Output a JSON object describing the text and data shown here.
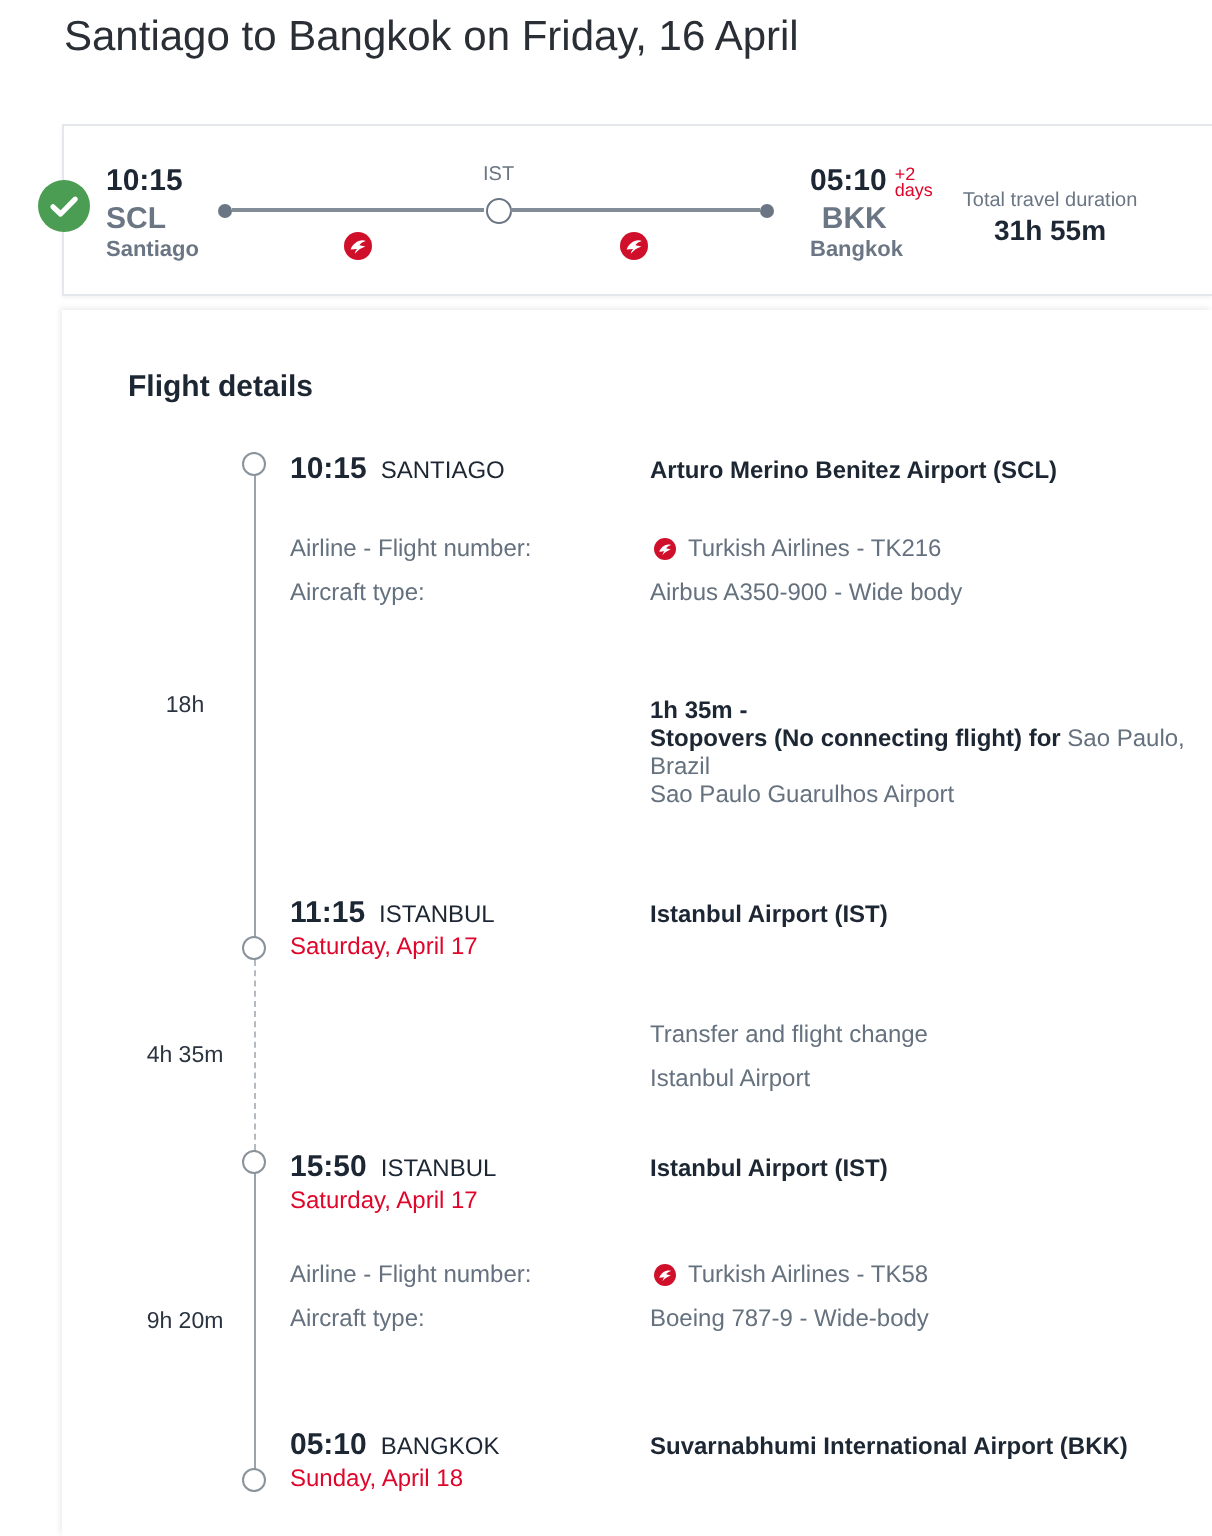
{
  "title": "Santiago to Bangkok on Friday, 16 April",
  "summary": {
    "departure": {
      "time": "10:15",
      "code": "SCL",
      "city": "Santiago"
    },
    "stops": [
      {
        "code": "IST"
      }
    ],
    "arrival": {
      "time": "05:10",
      "day_offset": "+2 days",
      "code": "BKK",
      "city": "Bangkok"
    },
    "total_duration": {
      "label": "Total travel duration",
      "value": "31h 55m"
    }
  },
  "details": {
    "heading": "Flight details",
    "timeline": [
      {
        "kind": "flight",
        "duration": "18h",
        "departure": {
          "time": "10:15",
          "city": "SANTIAGO",
          "airport": "Arturo Merino Benitez Airport (SCL)"
        },
        "info": [
          {
            "kind": "airline",
            "label": "Airline - Flight number:",
            "value": "Turkish Airlines - TK216"
          },
          {
            "kind": "aircraft",
            "label": "Aircraft type:",
            "value": "Airbus A350-900 - Wide body"
          }
        ],
        "stopover": {
          "duration": "1h 35m -",
          "note": "**Stopovers (No connecting flight) for** Sao Paulo, Brazil",
          "airport": "Sao Paulo Guarulhos Airport"
        },
        "arrival": {
          "time": "11:15",
          "city": "ISTANBUL",
          "date": "Saturday, April 17",
          "airport": "Istanbul Airport (IST)"
        }
      },
      {
        "kind": "transfer",
        "duration": "4h 35m",
        "lines": [
          "Transfer and flight change",
          "Istanbul Airport"
        ]
      },
      {
        "kind": "flight",
        "duration": "9h 20m",
        "departure": {
          "time": "15:50",
          "city": "ISTANBUL",
          "date": "Saturday, April 17",
          "airport": "Istanbul Airport (IST)"
        },
        "info": [
          {
            "kind": "airline",
            "label": "Airline - Flight number:",
            "value": "Turkish Airlines - TK58"
          },
          {
            "kind": "aircraft",
            "label": "Aircraft type:",
            "value": "Boeing 787-9 - Wide-body"
          }
        ],
        "arrival": {
          "time": "05:10",
          "city": "BANGKOK",
          "date": "Sunday, April 18",
          "airport": "Suvarnabhumi International Airport (BKK)"
        }
      }
    ]
  }
}
